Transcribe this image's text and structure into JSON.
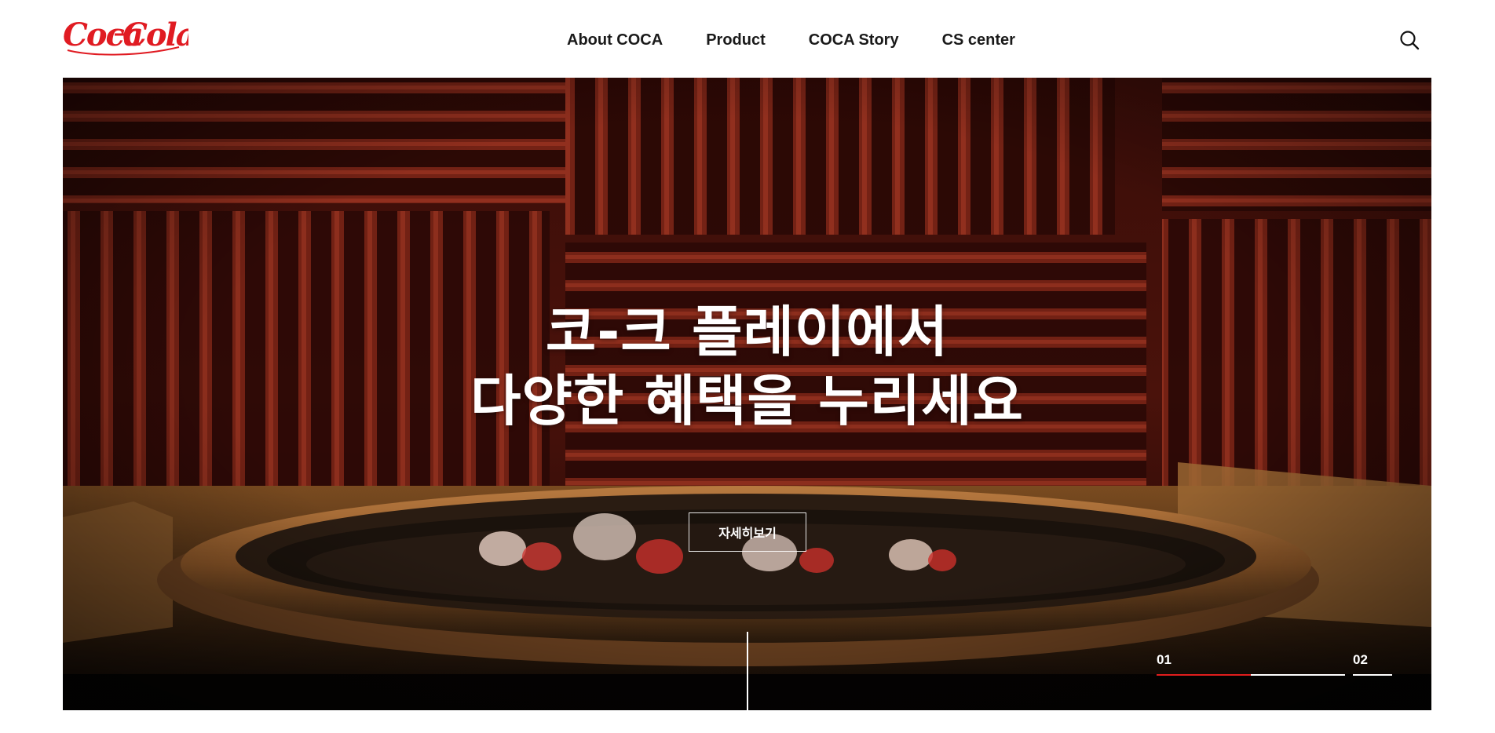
{
  "header": {
    "logo_text": "Coca-Cola",
    "nav": [
      {
        "label": "About COCA"
      },
      {
        "label": "Product"
      },
      {
        "label": "COCA Story"
      },
      {
        "label": "CS center"
      }
    ],
    "search_icon": "search-icon"
  },
  "hero": {
    "title_line1": "코-크 플레이에서",
    "title_line2": "다양한 혜택을 누리세요",
    "cta_label": "자세히보기",
    "pager": {
      "slide1": "01",
      "slide2": "02",
      "progress": 0.5
    }
  },
  "colors": {
    "brand_red": "#e11d1d",
    "text_dark": "#1a1a1a"
  }
}
